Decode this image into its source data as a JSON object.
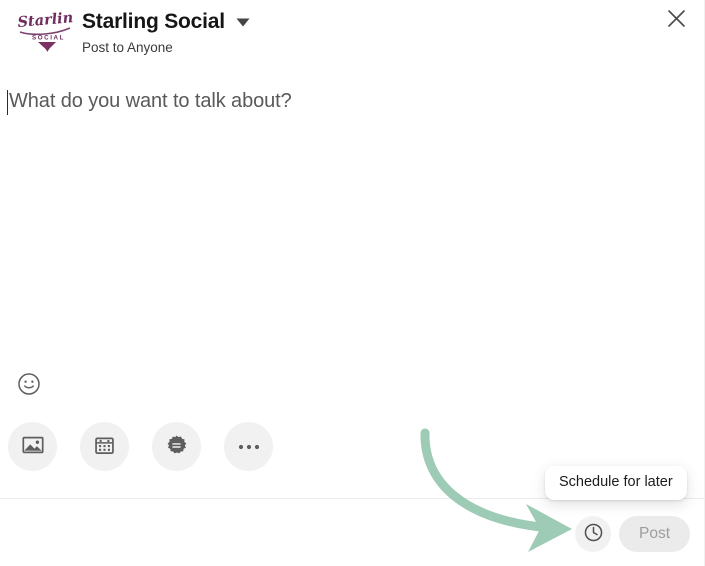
{
  "window": {
    "close_icon": "close-icon"
  },
  "header": {
    "logo": {
      "script_text": "Starling",
      "sub_text": "SOCIAL",
      "color": "#6E2E5E"
    },
    "account_name": "Starling Social",
    "audience_label": "Post to Anyone",
    "dropdown_icon": "chevron-down-icon"
  },
  "composer": {
    "placeholder": "What do you want to talk about?",
    "value": "",
    "caret_visible": true
  },
  "emoji": {
    "icon": "smiley-face-icon",
    "label": "Open emoji keyboard"
  },
  "attachments": [
    {
      "name": "add-media",
      "icon": "image-icon",
      "label": "Add a photo"
    },
    {
      "name": "add-event",
      "icon": "calendar-icon",
      "label": "Create an event"
    },
    {
      "name": "celebrate-occasion",
      "icon": "award-badge-icon",
      "label": "Celebrate an occasion"
    },
    {
      "name": "more-options",
      "icon": "ellipsis-icon",
      "label": "Open more options"
    }
  ],
  "tooltip": {
    "text": "Schedule for later",
    "visible": true
  },
  "actions": {
    "schedule_icon": "clock-icon",
    "schedule_label": "Schedule for later",
    "post_label": "Post",
    "post_disabled": true
  },
  "annotation": {
    "type": "curved-arrow",
    "color": "#9ECBB5",
    "points_to": "schedule-button"
  },
  "colors": {
    "brand_purple": "#6E2E5E",
    "annotation_green": "#9ECBB5",
    "tool_circle_bg": "#F1F1F1",
    "icon_gray": "#5E5E5E",
    "post_disabled_bg": "#EBEBEB",
    "post_disabled_text": "#9D9D9D",
    "divider": "#ECECEC"
  }
}
